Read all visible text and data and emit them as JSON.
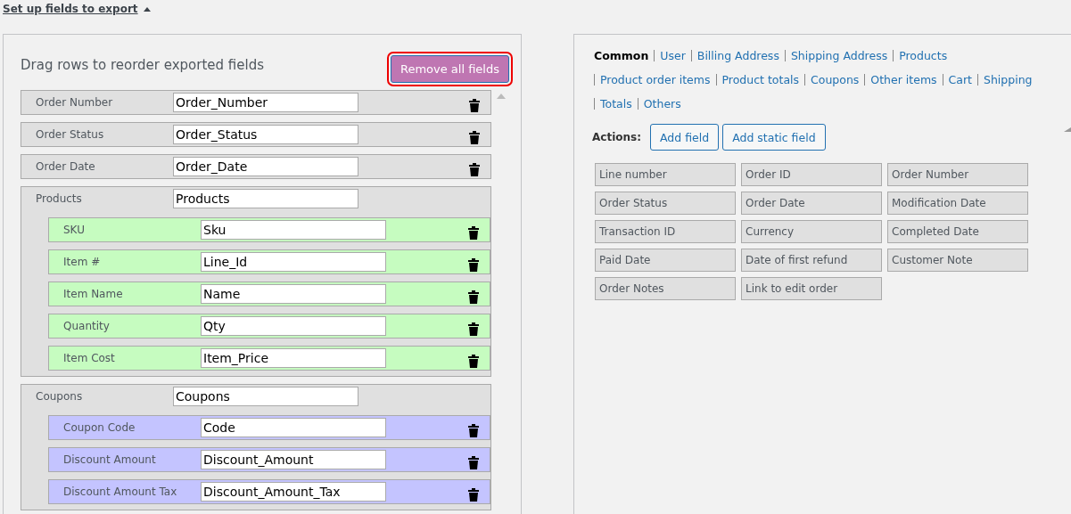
{
  "section_toggle": {
    "label": "Set up fields to export",
    "expanded": true
  },
  "left_panel": {
    "title": "Drag rows to reorder exported fields",
    "remove_button": {
      "label": "Remove all fields",
      "highlighted": true
    },
    "rows": [
      {
        "kind": "field",
        "label": "Order Number",
        "value": "Order_Number"
      },
      {
        "kind": "field",
        "label": "Order Status",
        "value": "Order_Status"
      },
      {
        "kind": "field",
        "label": "Order Date",
        "value": "Order_Date"
      },
      {
        "kind": "group",
        "label": "Products",
        "value": "Products",
        "color": "#c6fcc0",
        "children": [
          {
            "label": "SKU",
            "value": "Sku"
          },
          {
            "label": "Item #",
            "value": "Line_Id"
          },
          {
            "label": "Item Name",
            "value": "Name"
          },
          {
            "label": "Quantity",
            "value": "Qty"
          },
          {
            "label": "Item Cost",
            "value": "Item_Price"
          }
        ]
      },
      {
        "kind": "group",
        "label": "Coupons",
        "value": "Coupons",
        "color": "#c4c4ff",
        "children": [
          {
            "label": "Coupon Code",
            "value": "Code"
          },
          {
            "label": "Discount Amount",
            "value": "Discount_Amount"
          },
          {
            "label": "Discount Amount Tax",
            "value": "Discount_Amount_Tax"
          }
        ]
      }
    ]
  },
  "right_panel": {
    "tabs": [
      {
        "label": "Common",
        "selected": true
      },
      {
        "label": "User",
        "selected": false
      },
      {
        "label": "Billing Address",
        "selected": false
      },
      {
        "label": "Shipping Address",
        "selected": false
      },
      {
        "label": "Products",
        "selected": false
      },
      {
        "label": "Product order items",
        "selected": false
      },
      {
        "label": "Product totals",
        "selected": false
      },
      {
        "label": "Coupons",
        "selected": false
      },
      {
        "label": "Other items",
        "selected": false
      },
      {
        "label": "Cart",
        "selected": false
      },
      {
        "label": "Shipping",
        "selected": false
      },
      {
        "label": "Totals",
        "selected": false
      },
      {
        "label": "Others",
        "selected": false
      }
    ],
    "actions_label": "Actions:",
    "actions": [
      "Add field",
      "Add static field"
    ],
    "fields": [
      "Line number",
      "Order ID",
      "Order Number",
      "Order Status",
      "Order Date",
      "Modification Date",
      "Transaction ID",
      "Currency",
      "Completed Date",
      "Paid Date",
      "Date of first refund",
      "Customer Note",
      "Order Notes",
      "Link to edit order"
    ]
  }
}
